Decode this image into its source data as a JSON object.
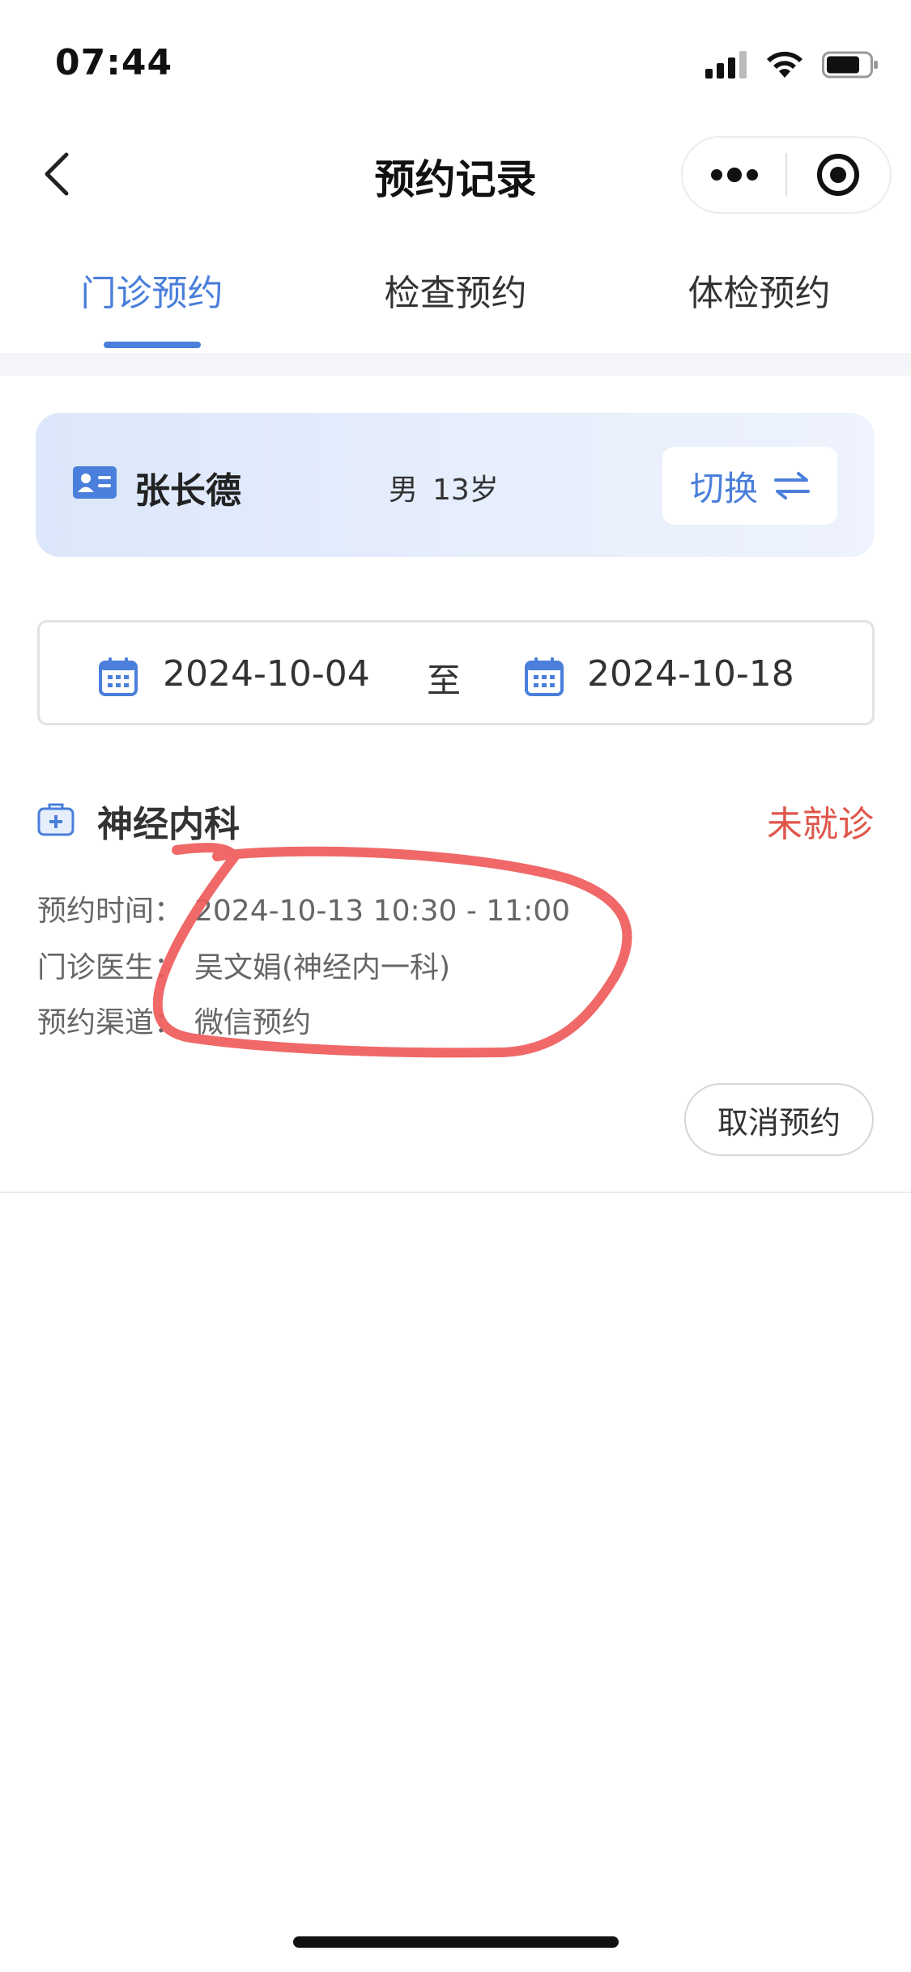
{
  "status_bar": {
    "time": "07:44",
    "icons": [
      "signal-icon",
      "wifi-icon",
      "battery-icon"
    ]
  },
  "nav": {
    "title": "预约记录",
    "back_icon": "chevron-left-icon",
    "more_icon": "more-dots-icon",
    "close_icon": "target-close-icon"
  },
  "tabs": [
    {
      "label": "门诊预约",
      "active": true
    },
    {
      "label": "检查预约",
      "active": false
    },
    {
      "label": "体检预约",
      "active": false
    }
  ],
  "patient": {
    "name": "张长德",
    "gender": "男",
    "age": "13岁",
    "switch_label": "切换",
    "id_icon": "id-card-icon",
    "switch_icon": "swap-arrows-icon"
  },
  "date_range": {
    "start": "2024-10-04",
    "separator": "至",
    "end": "2024-10-18",
    "icon": "calendar-icon"
  },
  "records": [
    {
      "department": "神经内科",
      "status": "未就诊",
      "rows": [
        {
          "label": "预约时间：",
          "value": "2024-10-13 10:30 - 11:00"
        },
        {
          "label": "门诊医生：",
          "value": "吴文娟(神经内一科)"
        },
        {
          "label": "预约渠道：",
          "value": "微信预约"
        }
      ],
      "action_label": "取消预约",
      "icon": "medical-kit-icon"
    }
  ],
  "colors": {
    "accent": "#4a7fdb",
    "status_pending": "#e0554a",
    "annotation": "#ef5b5b"
  }
}
